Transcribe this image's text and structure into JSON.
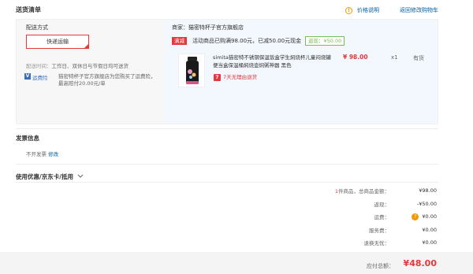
{
  "header": {
    "title": "送货清单",
    "price_info_label": "价格说明",
    "back_to_cart_label": "返回修改购物车"
  },
  "shipping": {
    "title": "配送方式",
    "method": "快递运输",
    "time_label": "配送时间：",
    "time_value": "工作日、双休日与节假日均可送货",
    "insurance_icon": "V",
    "insurance_label": "运费险",
    "insurance_desc": "猫密特杯子官方旗舰店为您购买了运费险，最高赔付20.00元/单"
  },
  "seller": {
    "name": "商家：猫密特杯子官方旗舰店"
  },
  "promo": {
    "tag": "满减",
    "text": "活动商品已购满98.00元，已减50.00元现金",
    "return_tag": "返现：¥50.00"
  },
  "product": {
    "title": "simita猫密特不锈钢保温饭盒学生焖烧杯儿童闷烧罐便当盒保温桶焖烧壶焖粥神器 黑色",
    "price": "¥ 98.00",
    "qty": "x1",
    "stock": "有货",
    "return_icon": "7",
    "return_note": "7天无理由退货"
  },
  "invoice": {
    "title": "发票信息",
    "value": "不开发票",
    "edit_label": "修改"
  },
  "coupon": {
    "title": "使用优惠/京东卡/抵用"
  },
  "summary": {
    "items": [
      {
        "count": "1",
        "label": "件商品，总商品金额：",
        "value": "¥98.00"
      },
      {
        "label": "返现：",
        "value": "-¥50.00"
      },
      {
        "label": "运费：",
        "value": "¥0.00",
        "icon": "?"
      },
      {
        "label": "服务费：",
        "value": "¥0.00"
      },
      {
        "label": "退换无忧：",
        "value": "¥0.00"
      }
    ],
    "total_label": "应付总额：",
    "total_value": "¥48.00"
  },
  "colors": {
    "accent_red": "#e4393c",
    "link_blue": "#005ea7",
    "green": "#7abd54",
    "orange": "#f29800"
  }
}
